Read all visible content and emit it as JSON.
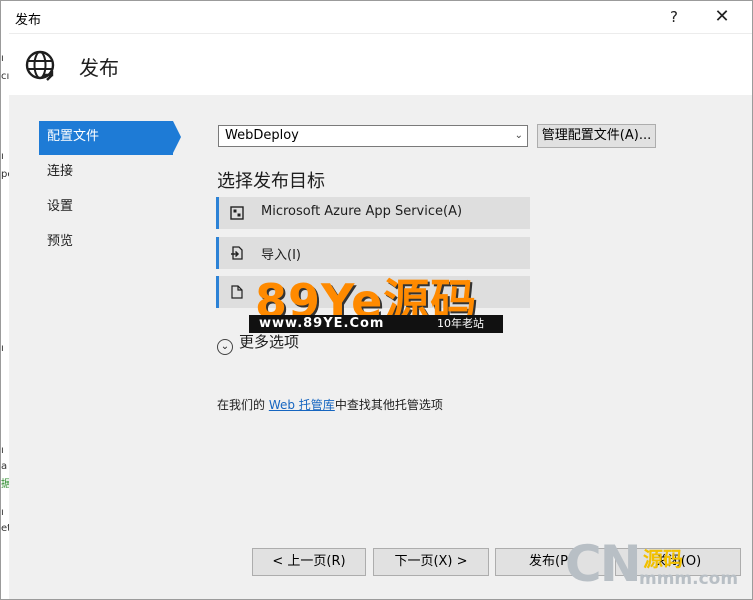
{
  "window": {
    "title": "发布",
    "help_glyph": "?",
    "close_glyph": "✕"
  },
  "header": {
    "title": "发布",
    "icon": "globe-publish-icon"
  },
  "left_strip": [
    "ı",
    "cı",
    "ı",
    "pe",
    "ı",
    "ı",
    "a",
    "据",
    "ı",
    "et"
  ],
  "nav": {
    "items": [
      {
        "label": "配置文件",
        "active": true
      },
      {
        "label": "连接",
        "active": false
      },
      {
        "label": "设置",
        "active": false
      },
      {
        "label": "预览",
        "active": false
      }
    ]
  },
  "profile": {
    "selected": "WebDeploy",
    "manage_label": "管理配置文件(A)..."
  },
  "targets": {
    "title": "选择发布目标",
    "items": [
      {
        "label": "Microsoft Azure App Service(A)",
        "icon": "azure-app-service-icon"
      },
      {
        "label": "导入(I)",
        "icon": "import-icon"
      },
      {
        "label": "",
        "icon": "file-icon"
      }
    ]
  },
  "more_options": {
    "label": "更多选项",
    "icon": "chevron-down-circle-icon"
  },
  "hosting": {
    "prefix": "在我们的 ",
    "link": "Web 托管库",
    "suffix": "中查找其他托管选项"
  },
  "footer": {
    "prev_label": "< 上一页(R)",
    "next_label": "下一页(X) >",
    "publish_label": "发布(P)",
    "close_label": "关闭(O)"
  },
  "watermark": {
    "big": "89Ye源码",
    "url": "www.89YE.Com",
    "tag": "10年老站"
  },
  "watermark2": {
    "cn": "CN",
    "src": "源码",
    "url": "mmm.com"
  }
}
